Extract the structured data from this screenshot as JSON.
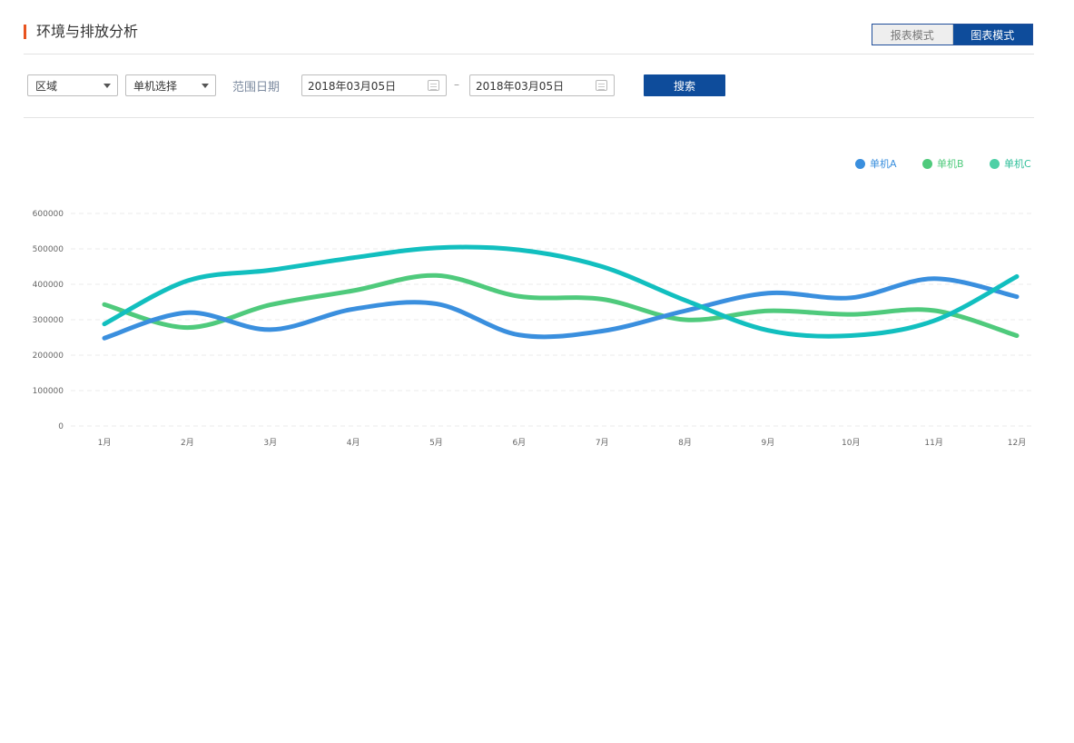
{
  "page": {
    "title": "环境与排放分析",
    "mode_switch": {
      "report_label": "报表模式",
      "chart_label": "图表模式",
      "active": "chart"
    }
  },
  "filters": {
    "region": {
      "label": "区域"
    },
    "unit": {
      "label": "单机选择"
    },
    "range_label": "范围日期",
    "date_start": "2018年03月05日",
    "date_separator": "–",
    "date_end": "2018年03月05日",
    "search_label": "搜索"
  },
  "colors": {
    "accent": "#0e4c9b",
    "title_marker": "#e8531f"
  },
  "chart_data": {
    "type": "line",
    "categories": [
      "1月",
      "2月",
      "3月",
      "4月",
      "5月",
      "6月",
      "7月",
      "8月",
      "9月",
      "10月",
      "11月",
      "12月"
    ],
    "y_ticks": [
      "0",
      "100000",
      "200000",
      "300000",
      "400000",
      "500000",
      "600000"
    ],
    "ylim": [
      0,
      600000
    ],
    "grid": true,
    "legend_position": "top-right",
    "series": [
      {
        "name": "单机A",
        "color": "#3a8fde",
        "values": [
          248000,
          320000,
          272000,
          330000,
          345000,
          257000,
          268000,
          325000,
          375000,
          362000,
          416000,
          365000
        ]
      },
      {
        "name": "单机B",
        "color": "#4fca7c",
        "values": [
          343000,
          278000,
          342000,
          382000,
          425000,
          366000,
          358000,
          300000,
          325000,
          315000,
          326000,
          255000
        ]
      },
      {
        "name": "单机C",
        "color": "#12bfbf",
        "values": [
          288000,
          410000,
          440000,
          475000,
          503000,
          497000,
          450000,
          355000,
          270000,
          255000,
          297000,
          422000
        ]
      }
    ]
  }
}
